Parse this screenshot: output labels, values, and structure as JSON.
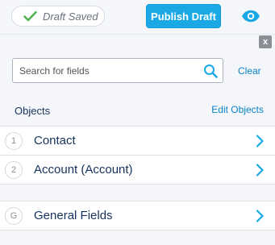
{
  "header": {
    "status": "Draft Saved",
    "publish_label": "Publish Draft"
  },
  "panel": {
    "close_label": "x",
    "search_placeholder": "Search for fields",
    "clear_label": "Clear",
    "objects_label": "Objects",
    "edit_objects_label": "Edit Objects",
    "items": [
      {
        "badge": "1",
        "label": "Contact"
      },
      {
        "badge": "2",
        "label": "Account (Account)"
      },
      {
        "badge": "G",
        "label": "General Fields"
      }
    ]
  },
  "colors": {
    "accent": "#1ba9e6",
    "link": "#0a84c8",
    "check": "#4caf50"
  }
}
